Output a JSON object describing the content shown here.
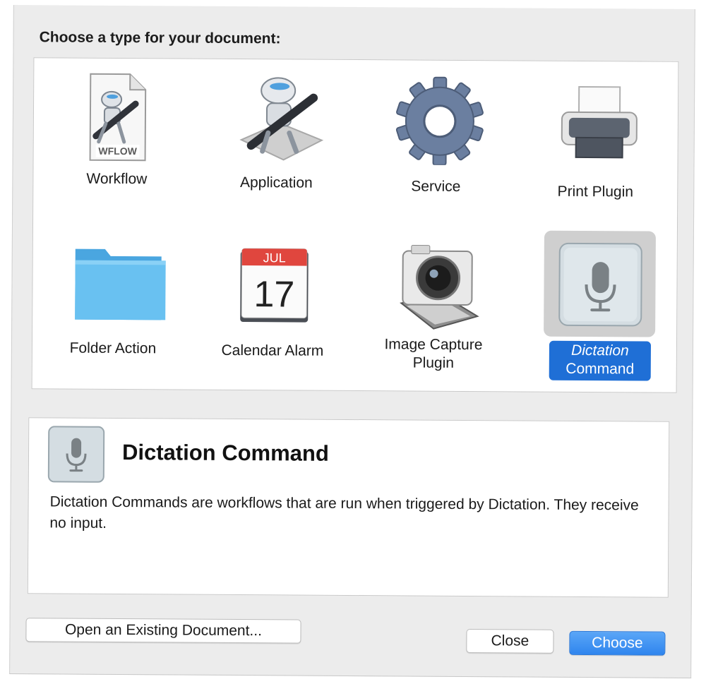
{
  "dialog": {
    "prompt": "Choose a type for your document:"
  },
  "types": [
    {
      "label": "Workflow",
      "icon": "workflow-file-icon",
      "badge": "WFLOW"
    },
    {
      "label": "Application",
      "icon": "automator-robot-icon"
    },
    {
      "label": "Service",
      "icon": "gear-icon"
    },
    {
      "label": "Print Plugin",
      "icon": "printer-icon"
    },
    {
      "label": "Folder Action",
      "icon": "folder-icon"
    },
    {
      "label": "Calendar Alarm",
      "icon": "calendar-icon",
      "month": "JUL",
      "day": "17"
    },
    {
      "label_line1": "Image Capture",
      "label_line2": "Plugin",
      "icon": "camera-icon"
    },
    {
      "label_line1": "Dictation",
      "label_line2": "Command",
      "icon": "microphone-icon",
      "selected": true
    }
  ],
  "description": {
    "title": "Dictation Command",
    "text": "Dictation Commands are workflows that are run when triggered by Dictation. They receive no input.",
    "icon": "microphone-icon"
  },
  "buttons": {
    "open_existing": "Open an Existing Document...",
    "close": "Close",
    "choose": "Choose"
  },
  "colors": {
    "selection": "#1f6fd6",
    "primary_button": "#2f85ee",
    "calendar_red": "#e0463e",
    "folder_blue": "#5cb5ec"
  }
}
